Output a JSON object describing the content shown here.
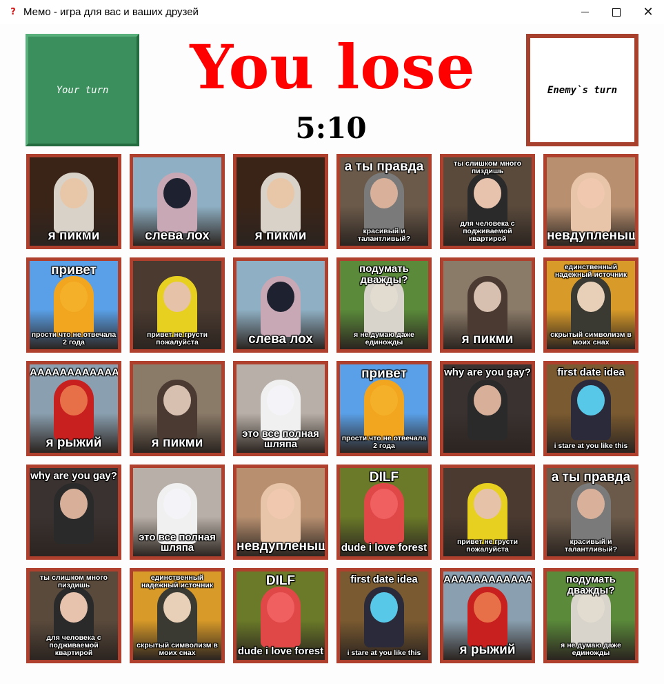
{
  "window": {
    "title": "Мемо - игра для вас и ваших друзей",
    "app_icon": "question-mark-icon",
    "controls": [
      "minimize-icon",
      "maximize-icon",
      "close-icon"
    ]
  },
  "header": {
    "your_turn": "Your turn",
    "enemy_turn": "Enemy`s turn",
    "result": "You lose",
    "score": "5:10"
  },
  "colors": {
    "result": "#ff0000",
    "your_turn_bg": "#3a8f5c",
    "card_border": "#b0402e"
  },
  "cards": [
    {
      "id": "pikmi-cotton",
      "top": "",
      "bottom": "я пикми",
      "bg": "#3a2418",
      "fig": "#d8d2c8",
      "head": "#e8c7a8"
    },
    {
      "id": "sleva-loh",
      "top": "",
      "bottom": "слева лох",
      "bg": "#8fb0c4",
      "fig": "#c8a8b4",
      "head": "#1e2230"
    },
    {
      "id": "pikmi-cotton",
      "top": "",
      "bottom": "я пикми",
      "bg": "#3a2418",
      "fig": "#d8d2c8",
      "head": "#e8c7a8"
    },
    {
      "id": "a-ty-pravda",
      "top": "а ты правда",
      "bottom": "красивый и талантливый?",
      "bg": "#6b5a4a",
      "fig": "#7a7a7a",
      "head": "#d9b09a"
    },
    {
      "id": "slishkom-mnogo",
      "top": "ты слишком много пиздишь",
      "bottom": "для человека с подживаемой квартирой",
      "bg": "#5a4a3c",
      "fig": "#2a2a2a",
      "head": "#e7c3ad"
    },
    {
      "id": "nevduplenysh",
      "top": "",
      "bottom": "невдупленыш",
      "bg": "#b89070",
      "fig": "#e8c4a8",
      "head": "#f0c8b0"
    },
    {
      "id": "privet",
      "top": "привет",
      "bottom": "прости что не отвечала 2 года",
      "bg": "#5aa0e8",
      "fig": "#f2a51f",
      "head": "#f5b02a"
    },
    {
      "id": "ne-grusti",
      "top": "",
      "bottom": "привет не грусти пожалуйста",
      "bg": "#4a3a30",
      "fig": "#e8d020",
      "head": "#e6c2a8"
    },
    {
      "id": "sleva-loh",
      "top": "",
      "bottom": "слева лох",
      "bg": "#8fb0c4",
      "fig": "#c8a8b4",
      "head": "#1e2230"
    },
    {
      "id": "podumat-dvazhdy",
      "top": "подумать дважды?",
      "bottom": "я не думаю даже единожды",
      "bg": "#5a8a3a",
      "fig": "#d8d4cc",
      "head": "#e2dcd0"
    },
    {
      "id": "pikmi-tree",
      "top": "",
      "bottom": "я пикми",
      "bg": "#8a7a68",
      "fig": "#4a3a32",
      "head": "#d8c0b0"
    },
    {
      "id": "istochnik",
      "top": "единственный надежный источник",
      "bottom": "скрытый символизм в моих снах",
      "bg": "#d89a28",
      "fig": "#3a3a32",
      "head": "#e8d0b8"
    },
    {
      "id": "ryzhiy",
      "top": "ААААААААААААААААА",
      "bottom": "я рыжий",
      "bg": "#8aa0b0",
      "fig": "#c8201e",
      "head": "#e87048"
    },
    {
      "id": "pikmi-tree",
      "top": "",
      "bottom": "я пикми",
      "bg": "#8a7a68",
      "fig": "#4a3a32",
      "head": "#d8c0b0"
    },
    {
      "id": "polnaya-shlyapa",
      "top": "",
      "bottom": "это все полная шляпа",
      "bg": "#b8b0a8",
      "fig": "#f0f0f0",
      "head": "#f4f4f8"
    },
    {
      "id": "privet",
      "top": "привет",
      "bottom": "прости что не отвечала 2 года",
      "bg": "#5aa0e8",
      "fig": "#f2a51f",
      "head": "#f5b02a"
    },
    {
      "id": "why-gay",
      "top": "why are you gay?",
      "bottom": "",
      "bg": "#3a3230",
      "fig": "#2a2a2a",
      "head": "#d8b09a"
    },
    {
      "id": "first-date",
      "top": "first date idea",
      "bottom": "i stare at you like this",
      "bg": "#7a5a30",
      "fig": "#2a2a3a",
      "head": "#58c8e8"
    },
    {
      "id": "why-gay",
      "top": "why are you gay?",
      "bottom": "",
      "bg": "#3a3230",
      "fig": "#2a2a2a",
      "head": "#d8b09a"
    },
    {
      "id": "polnaya-shlyapa",
      "top": "",
      "bottom": "это все полная шляпа",
      "bg": "#b8b0a8",
      "fig": "#f0f0f0",
      "head": "#f4f4f8"
    },
    {
      "id": "nevduplenysh",
      "top": "",
      "bottom": "невдупленыш",
      "bg": "#b89070",
      "fig": "#e8c4a8",
      "head": "#f0c8b0"
    },
    {
      "id": "dilf",
      "top": "DILF",
      "bottom": "dude i love forest",
      "bg": "#6a7a28",
      "fig": "#e04848",
      "head": "#f06060"
    },
    {
      "id": "ne-grusti",
      "top": "",
      "bottom": "привет не грусти пожалуйста",
      "bg": "#4a3a30",
      "fig": "#e8d020",
      "head": "#e6c2a8"
    },
    {
      "id": "a-ty-pravda",
      "top": "а ты правда",
      "bottom": "красивый и талантливый?",
      "bg": "#6b5a4a",
      "fig": "#7a7a7a",
      "head": "#d9b09a"
    },
    {
      "id": "slishkom-mnogo",
      "top": "ты слишком много пиздишь",
      "bottom": "для человека с подживаемой квартирой",
      "bg": "#5a4a3c",
      "fig": "#2a2a2a",
      "head": "#e7c3ad"
    },
    {
      "id": "istochnik",
      "top": "единственный надежный источник",
      "bottom": "скрытый символизм в моих снах",
      "bg": "#d89a28",
      "fig": "#3a3a32",
      "head": "#e8d0b8"
    },
    {
      "id": "dilf",
      "top": "DILF",
      "bottom": "dude i love forest",
      "bg": "#6a7a28",
      "fig": "#e04848",
      "head": "#f06060"
    },
    {
      "id": "first-date",
      "top": "first date idea",
      "bottom": "i stare at you like this",
      "bg": "#7a5a30",
      "fig": "#2a2a3a",
      "head": "#58c8e8"
    },
    {
      "id": "ryzhiy",
      "top": "ААААААААААААААААА",
      "bottom": "я рыжий",
      "bg": "#8aa0b0",
      "fig": "#c8201e",
      "head": "#e87048"
    },
    {
      "id": "podumat-dvazhdy",
      "top": "подумать дважды?",
      "bottom": "я не думаю даже единожды",
      "bg": "#5a8a3a",
      "fig": "#d8d4cc",
      "head": "#e2dcd0"
    }
  ]
}
